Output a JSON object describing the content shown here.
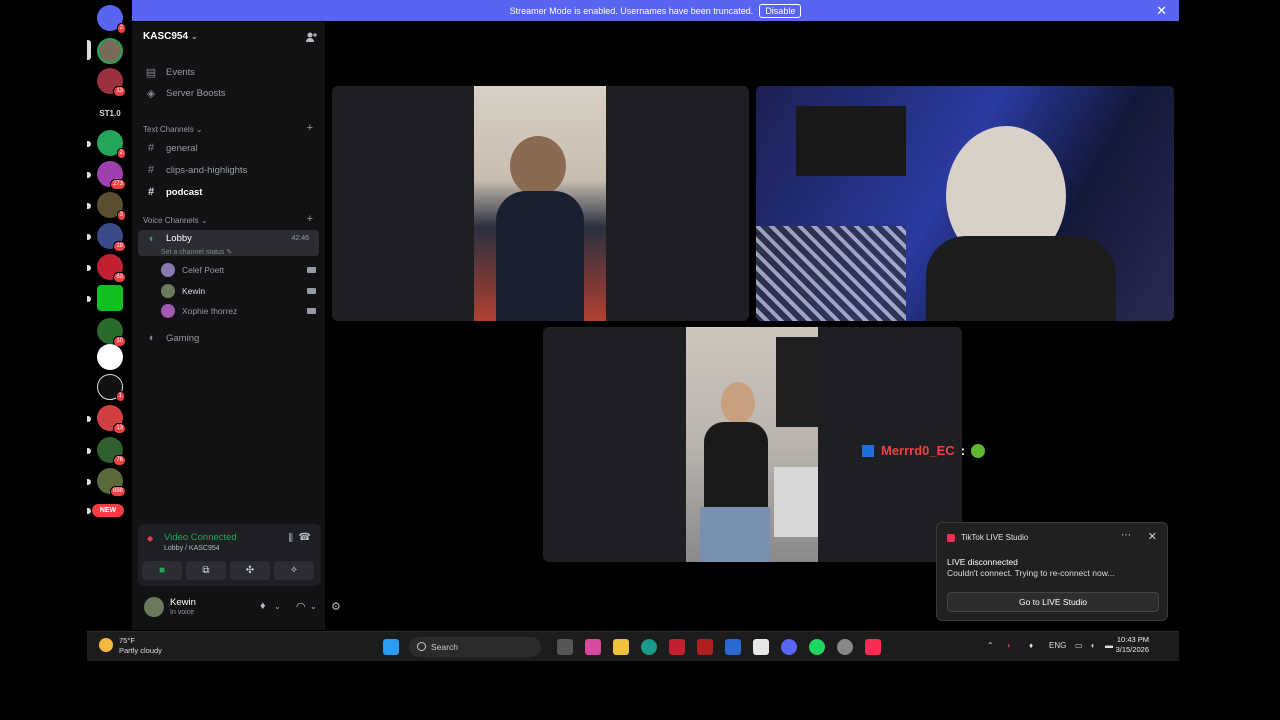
{
  "banner": {
    "text": "Streamer Mode is enabled. Usernames have been truncated.",
    "disable_label": "Disable"
  },
  "rail": {
    "badges": [
      "2",
      "13",
      "ST1.0",
      "2",
      "273",
      "3",
      "18",
      "63",
      "10",
      "1",
      "13",
      "76",
      "888",
      "NEW"
    ]
  },
  "server": {
    "name": "KASC954"
  },
  "nav": {
    "events": "Events",
    "boosts": "Server Boosts"
  },
  "text_channels": {
    "header": "Text Channels",
    "items": [
      "general",
      "clips-and-highlights",
      "podcast"
    ]
  },
  "voice_channels": {
    "header": "Voice Channels",
    "lobby": "Lobby",
    "lobby_timer": "42:46",
    "status": "Set a channel status",
    "members": [
      "Celef Poett",
      "Kewin",
      "Xophie thorrez"
    ],
    "gaming": "Gaming"
  },
  "voice_panel": {
    "state": "Video Connected",
    "location": "Lobby / KASC954"
  },
  "user": {
    "name": "Kewin",
    "status": "In voice"
  },
  "chat_overlay": {
    "user": "Merrrd0_EC",
    "sep": ":"
  },
  "toast": {
    "app": "TikTok LIVE Studio",
    "heading": "LIVE disconnected",
    "message": "Couldn't connect. Trying to re-connect now...",
    "button": "Go to LIVE Studio"
  },
  "taskbar": {
    "temp": "75°F",
    "weather": "Partly cloudy",
    "search": "Search",
    "lang": "ENG",
    "time": "10:43 PM",
    "date": "3/15/2026"
  },
  "colors": {
    "accent": "#5865f2",
    "speaking": "#23a55a",
    "danger": "#f23f43"
  }
}
